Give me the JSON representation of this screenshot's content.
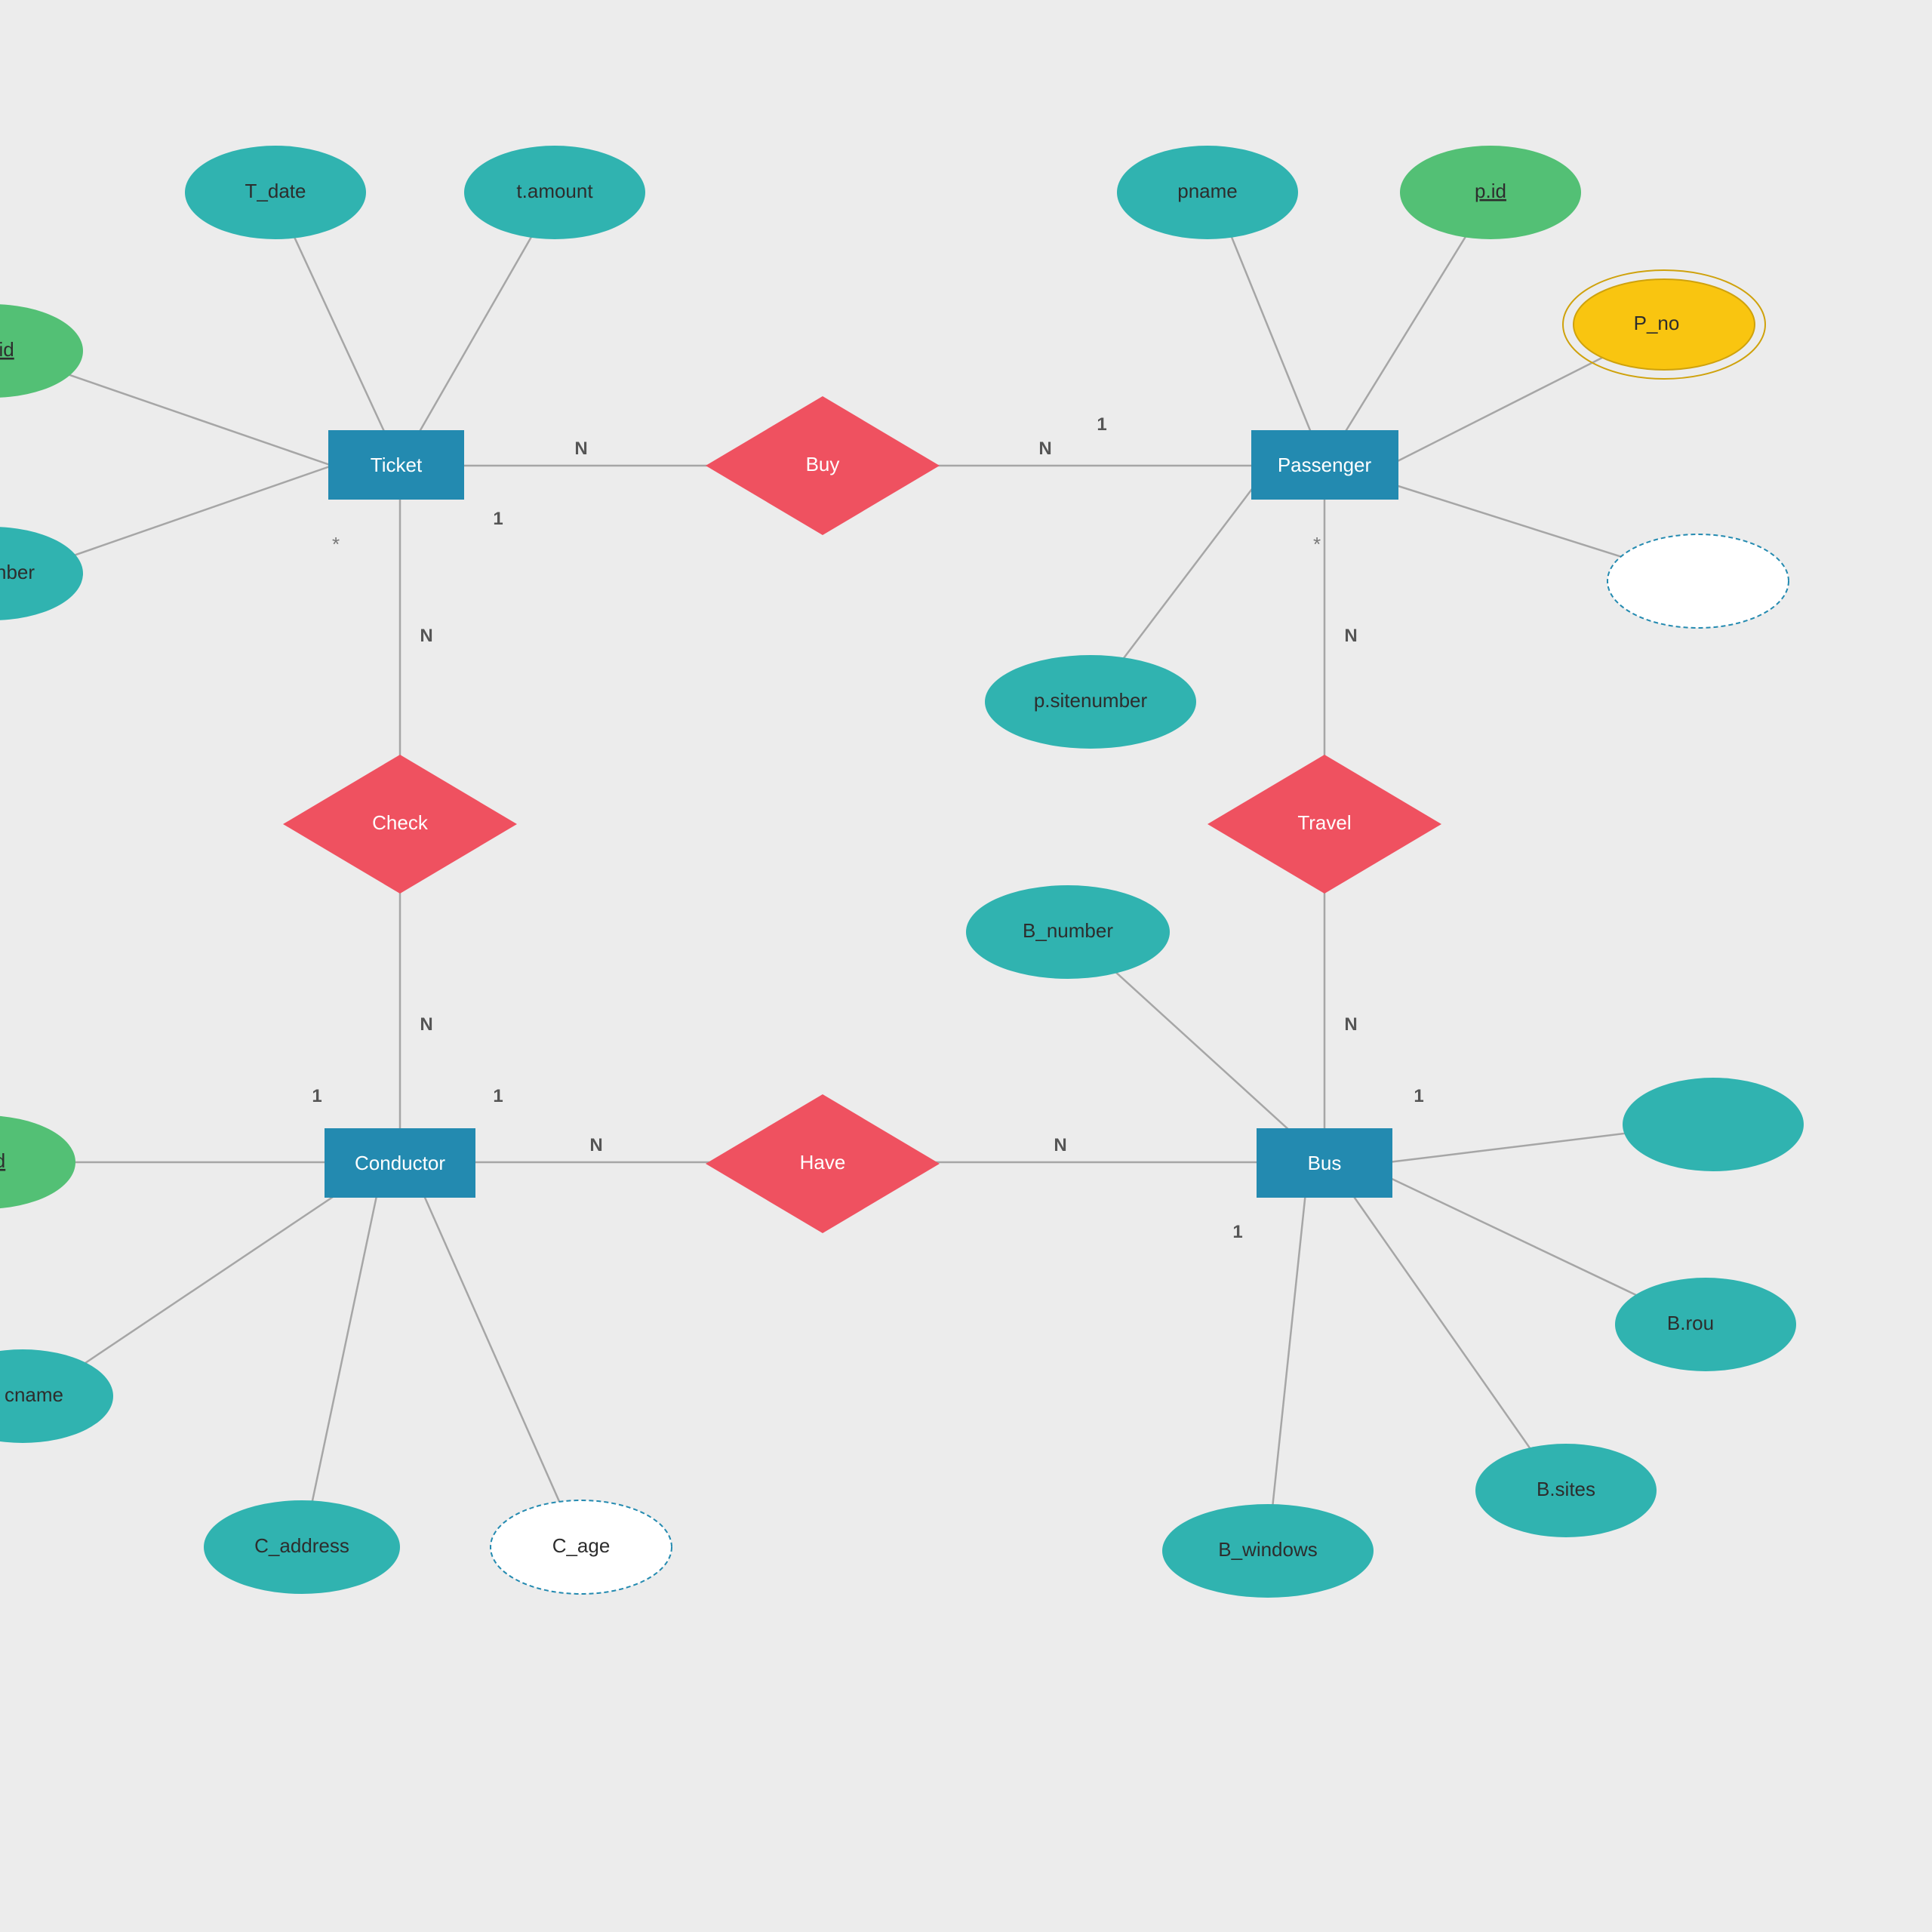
{
  "entities": {
    "ticket": "Ticket",
    "passenger": "Passenger",
    "conductor": "Conductor",
    "bus": "Bus"
  },
  "relationships": {
    "buy": "Buy",
    "check": "Check",
    "have": "Have",
    "travel": "Travel"
  },
  "attributes": {
    "t_date": "T_date",
    "t_amount": "t.amount",
    "t_id": ".id",
    "t_number": "nber",
    "pname": "pname",
    "p_id": "p.id",
    "p_no": "P_no",
    "p_sitenumber": "p.sitenumber",
    "c_id": "d",
    "cname": "cname",
    "c_address": "C_address",
    "c_age": "C_age",
    "b_number": "B_number",
    "b_windows": "B_windows",
    "b_sites": "B.sites",
    "b_route": "B.rou"
  },
  "cardinality": {
    "n": "N",
    "one": "1",
    "star": "*"
  }
}
